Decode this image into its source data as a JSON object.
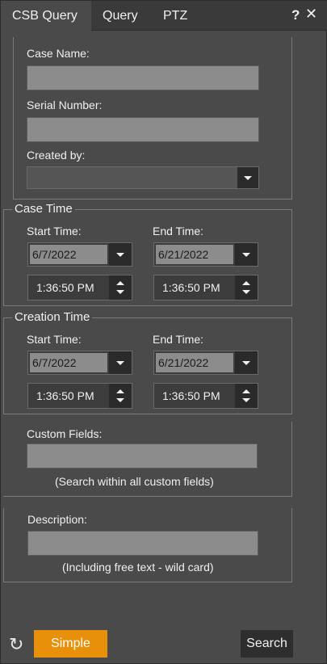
{
  "tabs": [
    {
      "label": "CSB Query",
      "active": true
    },
    {
      "label": "Query",
      "active": false
    },
    {
      "label": "PTZ",
      "active": false
    }
  ],
  "window_controls": {
    "help": "?",
    "close": "✕"
  },
  "case_info": {
    "case_name_label": "Case Name:",
    "case_name_value": "",
    "serial_number_label": "Serial Number:",
    "serial_number_value": "",
    "created_by_label": "Created by:",
    "created_by_value": ""
  },
  "case_time": {
    "title": "Case Time",
    "start_label": "Start Time:",
    "end_label": "End Time:",
    "start_date": "6/7/2022",
    "end_date": "6/21/2022",
    "start_time": "1:36:50 PM",
    "end_time": "1:36:50 PM"
  },
  "creation_time": {
    "title": "Creation Time",
    "start_label": "Start Time:",
    "end_label": "End Time:",
    "start_date": "6/7/2022",
    "end_date": "6/21/2022",
    "start_time": "1:36:50 PM",
    "end_time": "1:36:50 PM"
  },
  "custom_fields": {
    "label": "Custom Fields:",
    "value": "",
    "hint": "(Search within all custom fields)"
  },
  "description": {
    "label": "Description:",
    "value": "",
    "hint": "(Including free text - wild card)"
  },
  "footer": {
    "simple_label": "Simple",
    "search_label": "Search",
    "refresh_icon": "refresh-icon",
    "accent_color": "#e8900a"
  }
}
